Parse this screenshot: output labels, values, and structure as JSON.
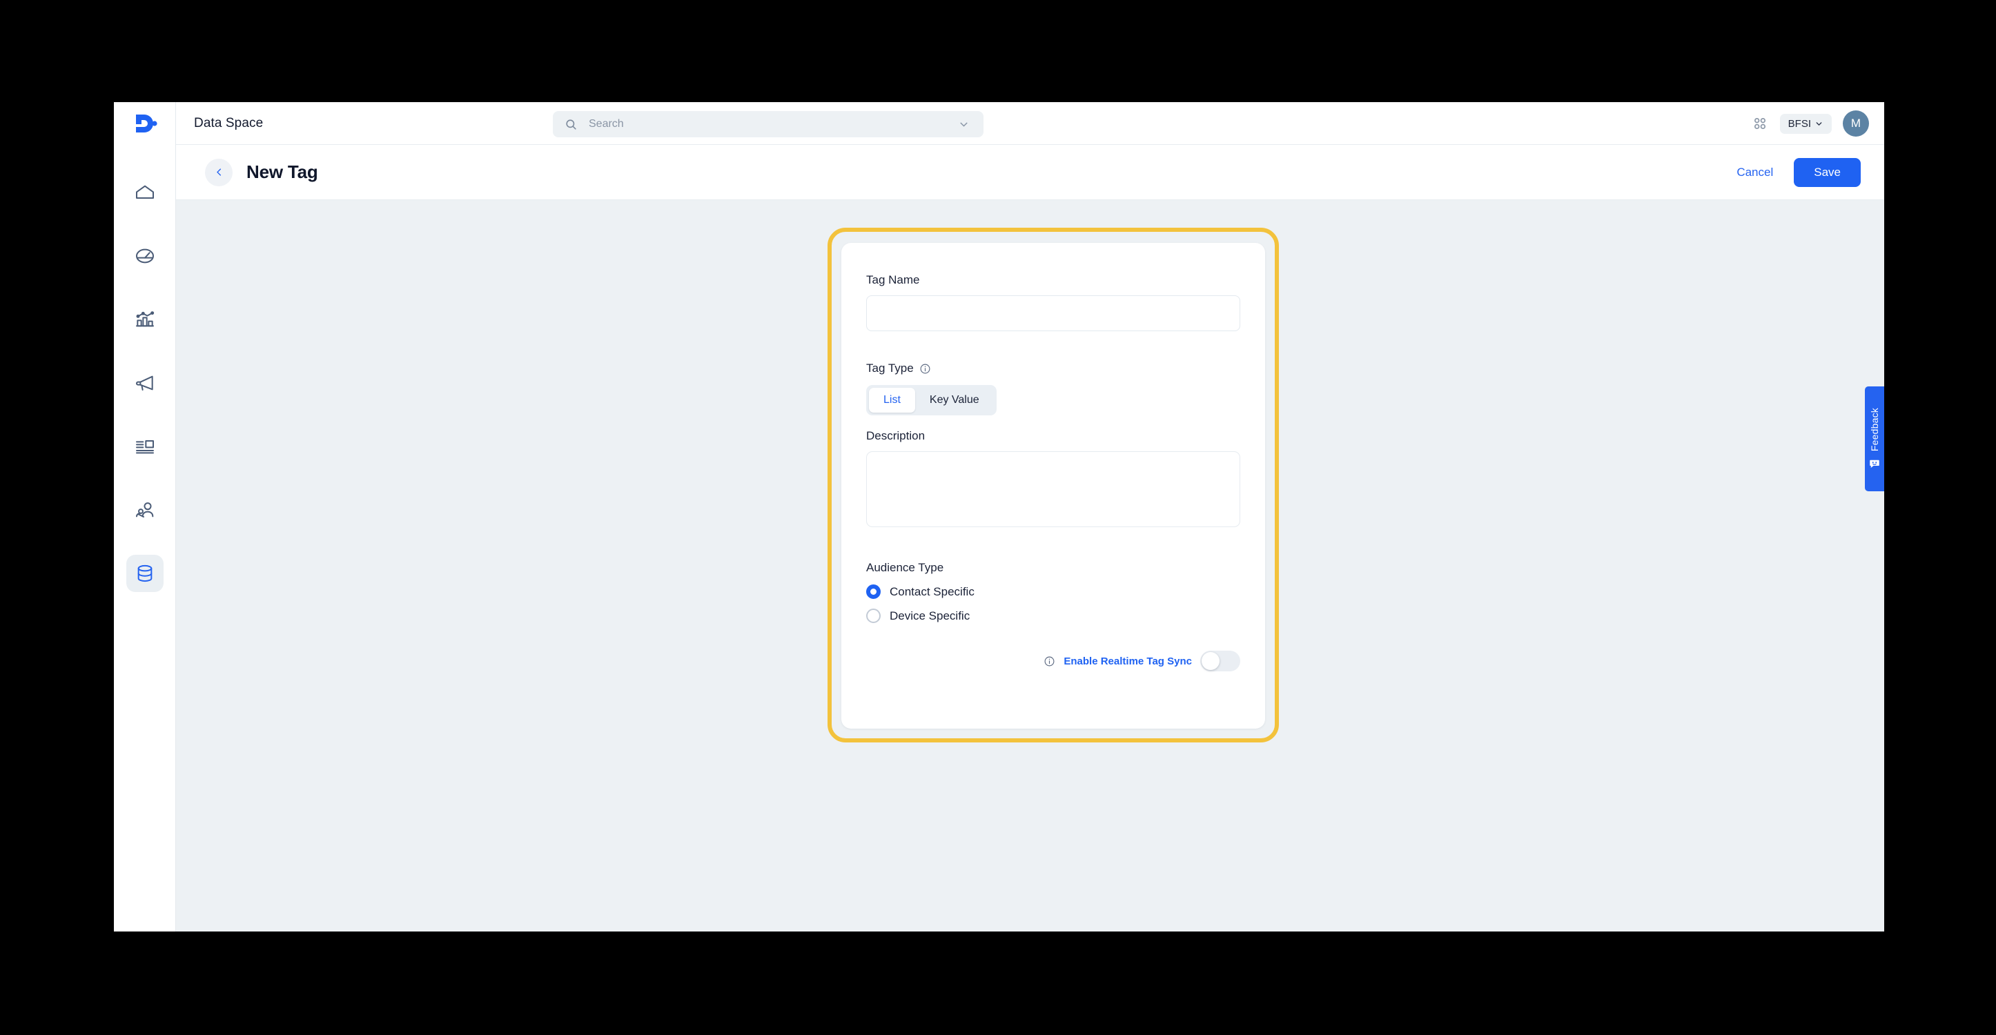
{
  "topbar": {
    "logo_icon": "dengage-d-logo-icon",
    "app_title": "Data Space",
    "search": {
      "icon": "search-icon",
      "placeholder": "Search",
      "value": "",
      "chevron_icon": "chevron-down-icon"
    },
    "apps_icon": "apps-grid-icon",
    "tenant": {
      "label": "BFSI",
      "chevron_icon": "chevron-down-icon"
    },
    "avatar_initial": "M"
  },
  "sidebar": {
    "items": [
      {
        "name": "home",
        "icon": "home-icon",
        "selected": false
      },
      {
        "name": "dashboard",
        "icon": "speedometer-icon",
        "selected": false
      },
      {
        "name": "analytics",
        "icon": "bar-chart-icon",
        "selected": false
      },
      {
        "name": "campaigns",
        "icon": "megaphone-icon",
        "selected": false
      },
      {
        "name": "content",
        "icon": "content-layout-icon",
        "selected": false
      },
      {
        "name": "audience",
        "icon": "people-icon",
        "selected": false
      },
      {
        "name": "data-space",
        "icon": "database-icon",
        "selected": true
      }
    ]
  },
  "page_header": {
    "back_icon": "chevron-left-icon",
    "title": "New Tag",
    "cancel_label": "Cancel",
    "save_label": "Save"
  },
  "form": {
    "tag_name": {
      "label": "Tag Name",
      "value": "",
      "placeholder": ""
    },
    "tag_type": {
      "label": "Tag Type",
      "info_icon": "info-icon",
      "options": [
        {
          "label": "List",
          "selected": true
        },
        {
          "label": "Key Value",
          "selected": false
        }
      ]
    },
    "description": {
      "label": "Description",
      "value": "",
      "placeholder": ""
    },
    "audience_type": {
      "label": "Audience Type",
      "options": [
        {
          "label": "Contact Specific",
          "selected": true
        },
        {
          "label": "Device Specific",
          "selected": false
        }
      ]
    },
    "realtime_sync": {
      "info_icon": "info-icon",
      "label": "Enable Realtime Tag Sync",
      "enabled": false
    }
  },
  "feedback": {
    "label": "Feedback",
    "icon": "smiley-speech-bubble-icon"
  },
  "colors": {
    "accent_blue": "#1f62f2",
    "link_blue": "#2563f0",
    "highlight_yellow": "#f3c23c",
    "canvas": "#edf1f4",
    "avatar": "#5c83a4"
  }
}
